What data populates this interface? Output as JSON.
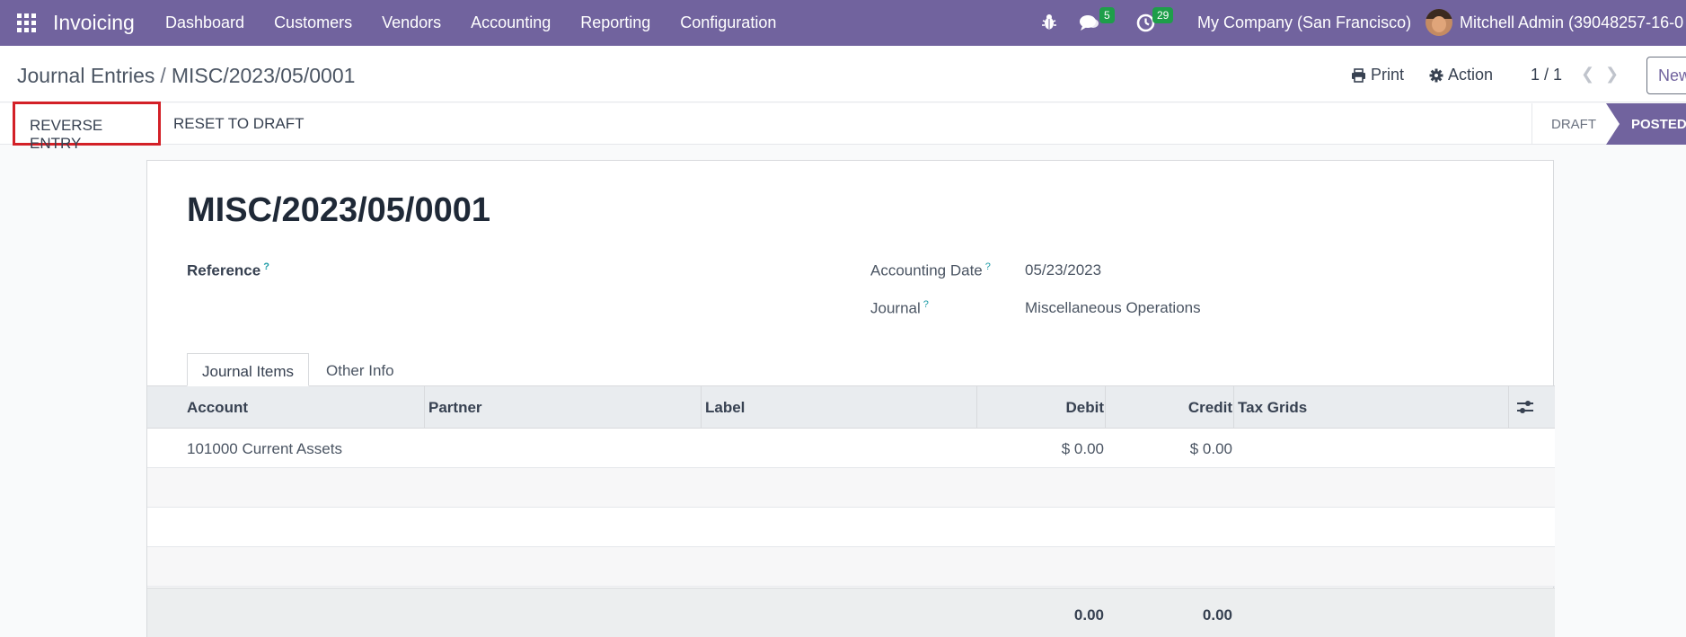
{
  "navbar": {
    "app_name": "Invoicing",
    "menu": [
      "Dashboard",
      "Customers",
      "Vendors",
      "Accounting",
      "Reporting",
      "Configuration"
    ],
    "messages_count": "5",
    "activities_count": "29",
    "company": "My Company (San Francisco)",
    "user": "Mitchell Admin (39048257-16-0"
  },
  "control": {
    "breadcrumb_parent": "Journal Entries",
    "breadcrumb_sep": "/",
    "breadcrumb_current": "MISC/2023/05/0001",
    "print_label": "Print",
    "action_label": "Action",
    "pager": "1 / 1",
    "new_label": "New"
  },
  "statusbar": {
    "reverse_label": "REVERSE ENTRY",
    "reset_label": "RESET TO DRAFT",
    "stage_draft": "DRAFT",
    "stage_posted": "POSTED"
  },
  "form": {
    "title": "MISC/2023/05/0001",
    "reference_label": "Reference",
    "accounting_date_label": "Accounting Date",
    "accounting_date": "05/23/2023",
    "journal_label": "Journal",
    "journal": "Miscellaneous Operations",
    "help_mark": "?"
  },
  "tabs": [
    "Journal Items",
    "Other Info"
  ],
  "grid": {
    "columns": [
      "Account",
      "Partner",
      "Label",
      "Debit",
      "Credit",
      "Tax Grids"
    ],
    "rows": [
      {
        "account": "101000 Current Assets",
        "partner": "",
        "label": "",
        "debit": "$ 0.00",
        "credit": "$ 0.00",
        "tax_grids": ""
      }
    ],
    "total_debit": "0.00",
    "total_credit": "0.00"
  },
  "colors": {
    "brand": "#71639e",
    "highlight": "#d32027",
    "badge": "#1e9e4a"
  }
}
